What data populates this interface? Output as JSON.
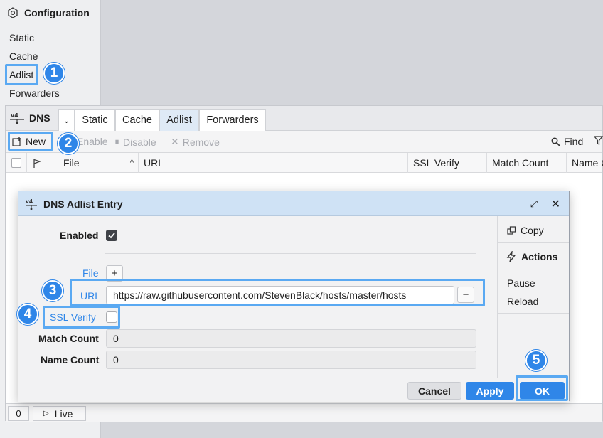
{
  "config": {
    "title": "Configuration",
    "items": [
      "Static",
      "Cache",
      "Adlist",
      "Forwarders"
    ]
  },
  "dns": {
    "title": "DNS",
    "tabs": [
      "Static",
      "Cache",
      "Adlist",
      "Forwarders"
    ],
    "active_tab": "Adlist",
    "toolbar": {
      "new": "New",
      "enable": "Enable",
      "disable": "Disable",
      "remove": "Remove",
      "find": "Find"
    },
    "columns": [
      "File",
      "URL",
      "SSL Verify",
      "Match Count",
      "Name Count"
    ],
    "status": {
      "count": "0",
      "live": "Live"
    }
  },
  "dialog": {
    "title": "DNS Adlist Entry",
    "labels": {
      "enabled": "Enabled",
      "file": "File",
      "url": "URL",
      "ssl_verify": "SSL Verify",
      "match_count": "Match Count",
      "name_count": "Name Count"
    },
    "values": {
      "enabled": true,
      "url": "https://raw.githubusercontent.com/StevenBlack/hosts/master/hosts",
      "ssl_verify": false,
      "match_count": "0",
      "name_count": "0"
    },
    "side": {
      "copy": "Copy",
      "actions": "Actions",
      "pause": "Pause",
      "reload": "Reload"
    },
    "buttons": {
      "cancel": "Cancel",
      "apply": "Apply",
      "ok": "OK"
    }
  },
  "callouts": [
    "1",
    "2",
    "3",
    "4",
    "5"
  ],
  "colors": {
    "accent": "#2f86e8",
    "highlight": "#5aa9f2",
    "dialog_titlebar": "#cfe2f5"
  }
}
